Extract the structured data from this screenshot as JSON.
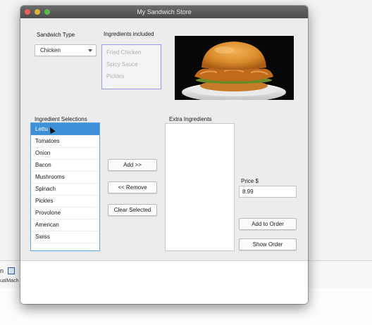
{
  "background": {
    "ide_text_1": "n",
    "ide_text_2": "ualMach"
  },
  "window": {
    "title": "My Sandwich Store"
  },
  "sandwich_type": {
    "label": "Sandwich Type",
    "selected": "Chicken"
  },
  "ingredients_included": {
    "label": "Ingredients included",
    "items": [
      "Fried Chicken",
      "Spicy Sauce",
      "Pickles"
    ]
  },
  "photo": {
    "icon": "chicken-sandwich-image"
  },
  "ingredient_selections": {
    "label": "Ingredient Selections",
    "selected_index": 0,
    "items": [
      "Lettu",
      "Tomatoes",
      "Onion",
      "Bacon",
      "Mushrooms",
      "Spinach",
      "Pickles",
      "Provolone",
      "American",
      "Swiss"
    ]
  },
  "buttons": {
    "add": "Add >>",
    "remove": "<< Remove",
    "clear": "Clear Selected",
    "add_to_order": "Add to Order",
    "show_order": "Show Order"
  },
  "extra_ingredients": {
    "label": "Extra Ingredients"
  },
  "price": {
    "label": "Price $",
    "value": "8.99"
  },
  "colors": {
    "accent": "#3e91d6",
    "title_bar": "#5a5a5a"
  }
}
